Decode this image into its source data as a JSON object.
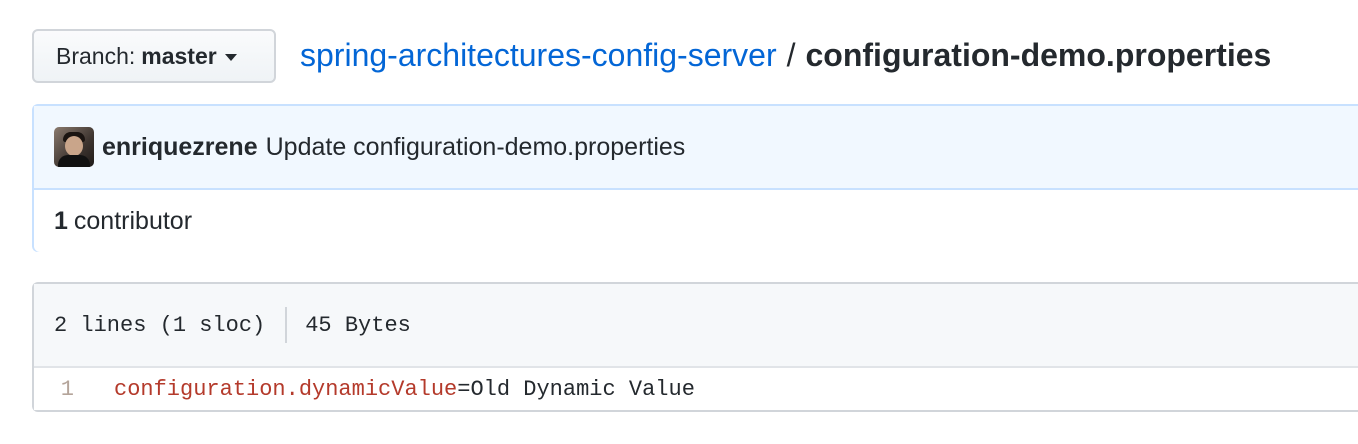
{
  "branch": {
    "prefix": "Branch:",
    "name": "master"
  },
  "breadcrumb": {
    "repo": "spring-architectures-config-server",
    "separator": "/",
    "file": "configuration-demo.properties"
  },
  "commit": {
    "author": "enriquezrene",
    "message": "Update configuration-demo.properties"
  },
  "contributors": {
    "count": "1",
    "label": "contributor"
  },
  "file_info": {
    "lines": "2 lines (1 sloc)",
    "size": "45 Bytes"
  },
  "code": {
    "lines": [
      {
        "number": "1",
        "key": "configuration.dynamicValue",
        "operator": "=",
        "value": "Old Dynamic Value"
      }
    ]
  },
  "colors": {
    "link": "#0366d6",
    "commit_bg": "#f1f8ff",
    "commit_border": "#c8e1ff",
    "code_key": "#b43a2b"
  },
  "icons": {
    "branch_dropdown": "caret-down-icon"
  }
}
